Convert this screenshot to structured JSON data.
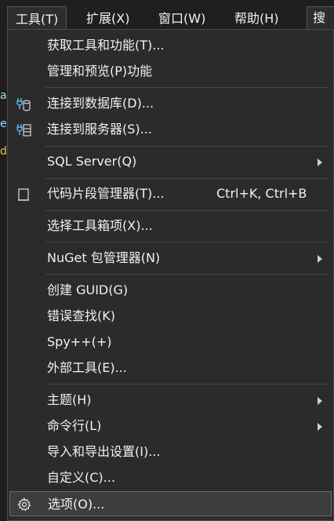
{
  "menubar": {
    "tools": "工具(T)",
    "extensions": "扩展(X)",
    "window": "窗口(W)",
    "help": "帮助(H)",
    "search": "搜索"
  },
  "background": {
    "frag1": "a",
    "frag2": "e",
    "frag3": "d"
  },
  "menu": {
    "get_tools": "获取工具和功能(T)...",
    "manage_preview": "管理和预览(P)功能",
    "connect_db": "连接到数据库(D)...",
    "connect_server": "连接到服务器(S)...",
    "sql_server": "SQL Server(Q)",
    "snippets": "代码片段管理器(T)...",
    "snippets_shortcut": "Ctrl+K, Ctrl+B",
    "choose_toolbox": "选择工具箱项(X)...",
    "nuget": "NuGet 包管理器(N)",
    "create_guid": "创建 GUID(G)",
    "error_lookup": "错误查找(K)",
    "spy": "Spy++(+)",
    "external_tools": "外部工具(E)...",
    "theme": "主题(H)",
    "command_line": "命令行(L)",
    "import_export": "导入和导出设置(I)...",
    "customize": "自定义(C)...",
    "options": "选项(O)..."
  }
}
